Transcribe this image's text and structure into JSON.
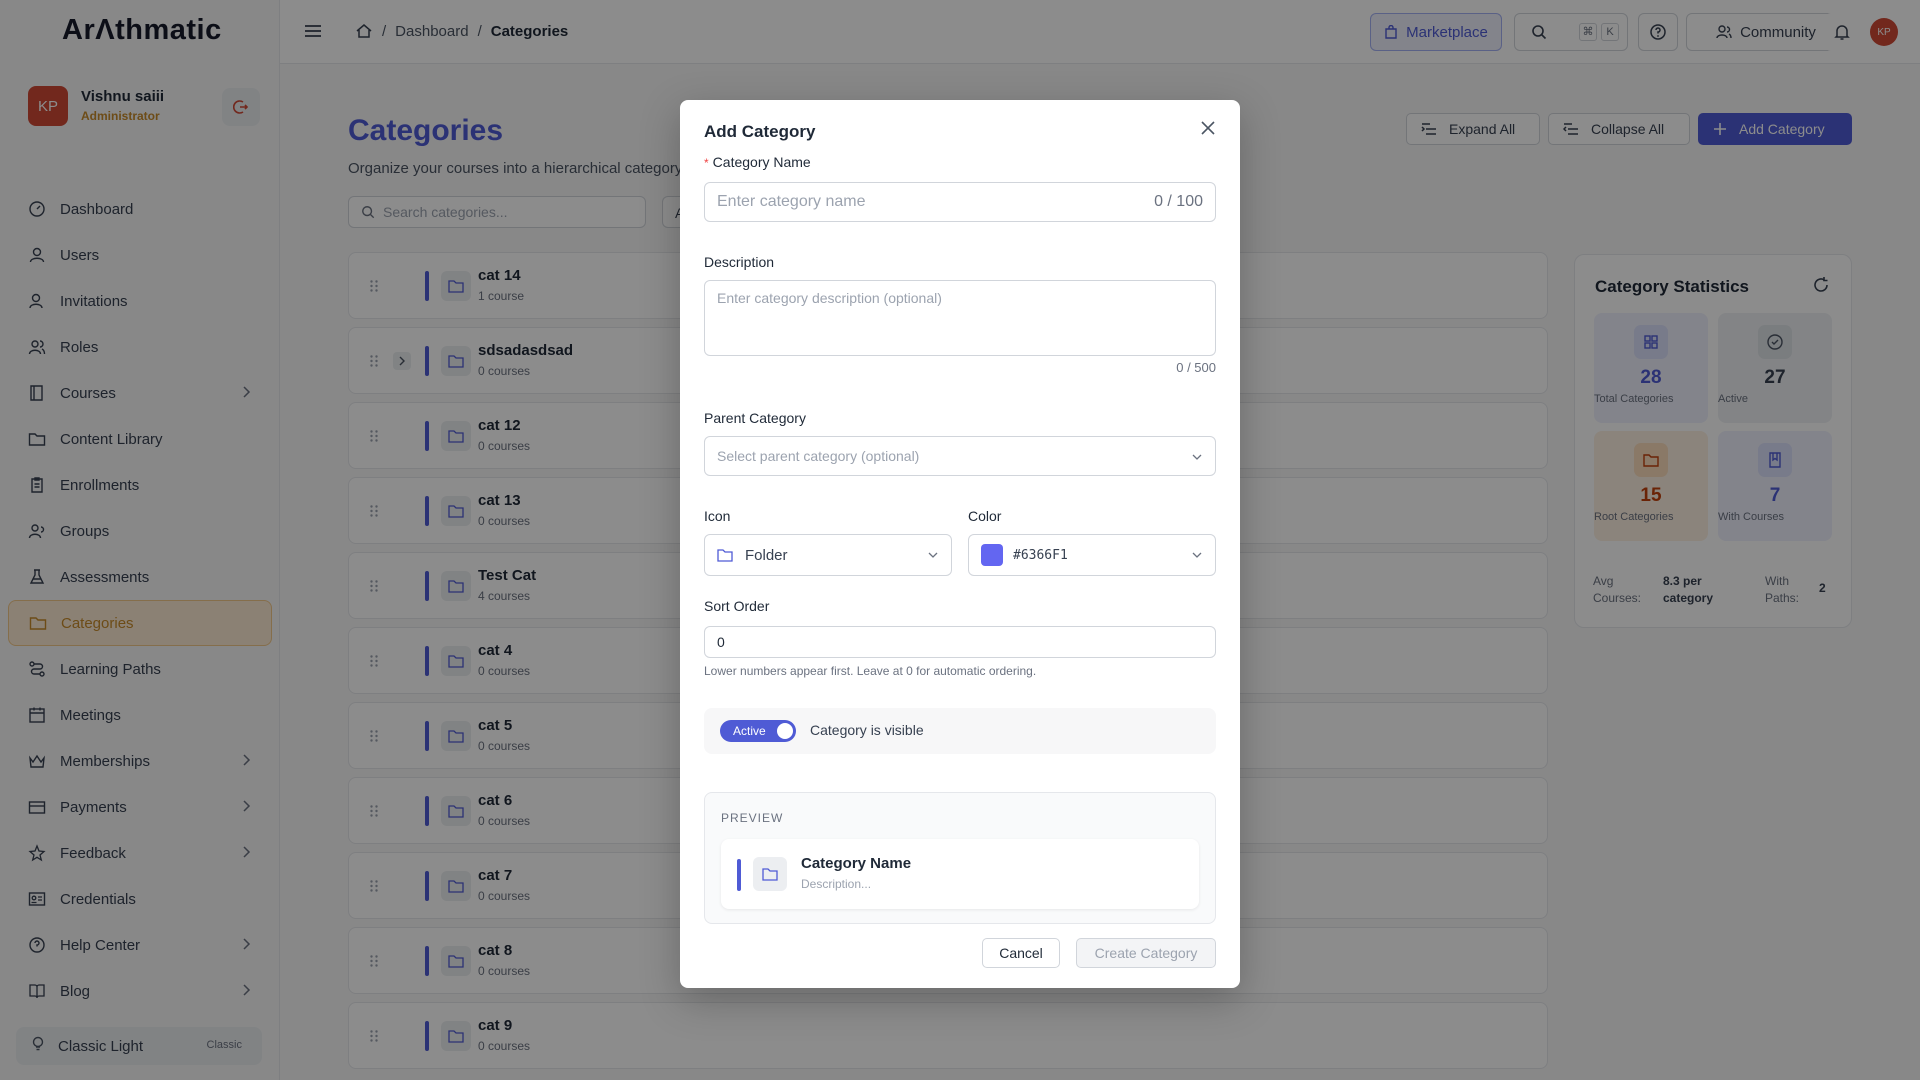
{
  "app": {
    "logo": "ArΛthmatic"
  },
  "user": {
    "initials": "KP",
    "name": "Vishnu saiii",
    "role": "Administrator"
  },
  "nav": [
    {
      "label": "Dashboard",
      "icon": "gauge-icon",
      "has_children": false
    },
    {
      "label": "Users",
      "icon": "user-icon",
      "has_children": false
    },
    {
      "label": "Invitations",
      "icon": "user-plus-icon",
      "has_children": false
    },
    {
      "label": "Roles",
      "icon": "users-icon",
      "has_children": false
    },
    {
      "label": "Courses",
      "icon": "book-icon",
      "has_children": true
    },
    {
      "label": "Content Library",
      "icon": "folder-icon",
      "has_children": false
    },
    {
      "label": "Enrollments",
      "icon": "clipboard-icon",
      "has_children": false
    },
    {
      "label": "Groups",
      "icon": "group-icon",
      "has_children": false
    },
    {
      "label": "Assessments",
      "icon": "flask-icon",
      "has_children": false
    },
    {
      "label": "Categories",
      "icon": "folder-icon",
      "has_children": false,
      "active": true
    },
    {
      "label": "Learning Paths",
      "icon": "path-icon",
      "has_children": false
    },
    {
      "label": "Meetings",
      "icon": "calendar-icon",
      "has_children": false
    },
    {
      "label": "Memberships",
      "icon": "crown-icon",
      "has_children": true
    },
    {
      "label": "Payments",
      "icon": "card-icon",
      "has_children": true
    },
    {
      "label": "Feedback",
      "icon": "star-icon",
      "has_children": true
    },
    {
      "label": "Credentials",
      "icon": "id-card-icon",
      "has_children": false
    },
    {
      "label": "Help Center",
      "icon": "help-icon",
      "has_children": true
    },
    {
      "label": "Blog",
      "icon": "book-open-icon",
      "has_children": true
    }
  ],
  "theme": {
    "label": "Classic Light",
    "tag": "Classic"
  },
  "topbar": {
    "breadcrumbs": [
      "Dashboard",
      "Categories"
    ],
    "marketplace": "Marketplace",
    "kbd1": "⌘",
    "kbd2": "K",
    "community": "Community",
    "avatar": "KP"
  },
  "page": {
    "title": "Categories",
    "subtitle": "Organize your courses into a hierarchical category s",
    "search_placeholder": "Search categories...",
    "filter_stub": "A",
    "expand_all": "Expand All",
    "collapse_all": "Collapse All",
    "add_category": "Add Category"
  },
  "categories": [
    {
      "name": "cat 14",
      "count": "1 course",
      "expandable": false
    },
    {
      "name": "sdsadasdsad",
      "count": "0 courses",
      "expandable": true
    },
    {
      "name": "cat 12",
      "count": "0 courses",
      "expandable": false
    },
    {
      "name": "cat 13",
      "count": "0 courses",
      "expandable": false
    },
    {
      "name": "Test Cat",
      "count": "4 courses",
      "expandable": false
    },
    {
      "name": "cat 4",
      "count": "0 courses",
      "expandable": false
    },
    {
      "name": "cat 5",
      "count": "0 courses",
      "expandable": false
    },
    {
      "name": "cat 6",
      "count": "0 courses",
      "expandable": false
    },
    {
      "name": "cat 7",
      "count": "0 courses",
      "expandable": false
    },
    {
      "name": "cat 8",
      "count": "0 courses",
      "expandable": false
    },
    {
      "name": "cat 9",
      "count": "0 courses",
      "expandable": false
    }
  ],
  "stats": {
    "title": "Category Statistics",
    "tiles": [
      {
        "value": "28",
        "label": "Total Categories"
      },
      {
        "value": "27",
        "label": "Active"
      },
      {
        "value": "15",
        "label": "Root Categories"
      },
      {
        "value": "7",
        "label": "With Courses"
      }
    ],
    "avg_label": "Avg Courses:",
    "avg_value": "8.3 per category",
    "paths_label": "With Paths:",
    "paths_value": "2"
  },
  "modal": {
    "title": "Add Category",
    "name_label": "Category Name",
    "name_required": "*",
    "name_placeholder": "Enter category name",
    "name_count": "0 / 100",
    "desc_label": "Description",
    "desc_placeholder": "Enter category description (optional)",
    "desc_count": "0 / 500",
    "parent_label": "Parent Category",
    "parent_placeholder": "Select parent category (optional)",
    "icon_label": "Icon",
    "icon_value": "Folder",
    "color_label": "Color",
    "color_value": "#6366F1",
    "sort_label": "Sort Order",
    "sort_value": "0",
    "sort_hint": "Lower numbers appear first. Leave at 0 for automatic ordering.",
    "toggle_label": "Active",
    "visible_text": "Category is visible",
    "preview_label": "PREVIEW",
    "preview_name": "Category Name",
    "preview_desc": "Description...",
    "cancel": "Cancel",
    "create": "Create Category"
  },
  "colors": {
    "accent": "#4f5bd5",
    "sidebar_active": "#c78a2a",
    "category_color": "#6366F1"
  }
}
